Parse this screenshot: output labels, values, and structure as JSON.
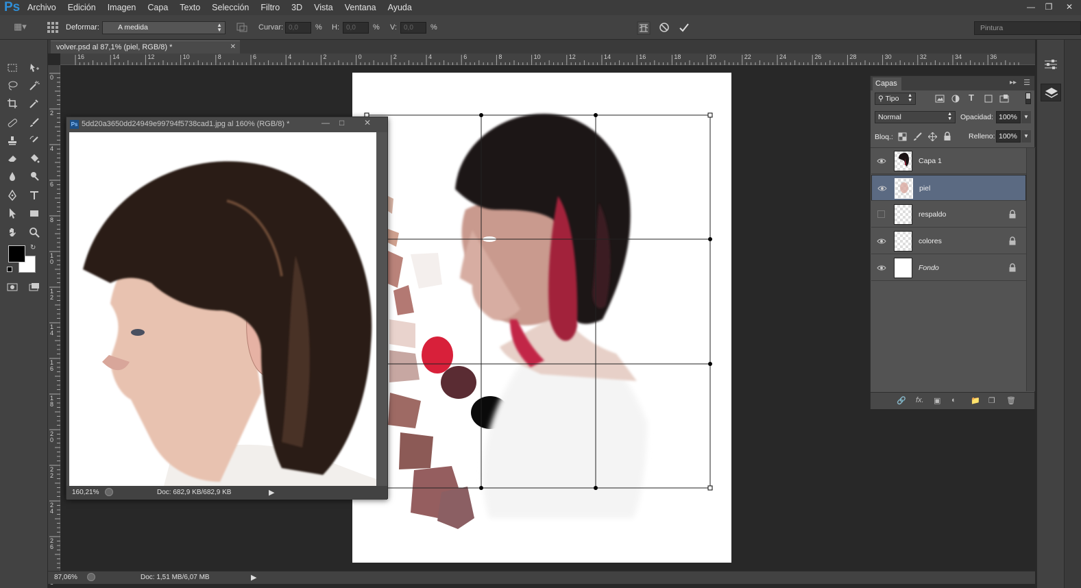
{
  "app": {
    "logo": "Ps",
    "menu": [
      "Archivo",
      "Edición",
      "Imagen",
      "Capa",
      "Texto",
      "Selección",
      "Filtro",
      "3D",
      "Vista",
      "Ventana",
      "Ayuda"
    ]
  },
  "options": {
    "warp_label": "Deformar:",
    "warp_value": "A medida",
    "bend_label": "Curvar:",
    "bend_value": "0,0",
    "pct": "%",
    "h_label": "H:",
    "h_value": "0,0",
    "v_label": "V:",
    "v_value": "0,0",
    "workspace": "Pintura"
  },
  "document": {
    "tab_title": "volver.psd al 87,1% (piel, RGB/8) *",
    "zoom": "87,06%",
    "doc_info": "Doc: 1,51 MB/6,07 MB"
  },
  "ruler": {
    "h": [
      "16",
      "14",
      "12",
      "10",
      "8",
      "6",
      "4",
      "2",
      "0",
      "2",
      "4",
      "6",
      "8",
      "10",
      "12",
      "14",
      "16",
      "18",
      "20",
      "22",
      "24",
      "26",
      "28",
      "30",
      "32",
      "34",
      "36"
    ],
    "v": [
      "0",
      "2",
      "4",
      "6",
      "8",
      "1\n0",
      "1\n2",
      "1\n4",
      "1\n6",
      "1\n8",
      "2\n0",
      "2\n2",
      "2\n4",
      "2\n6",
      "2\n8"
    ]
  },
  "float_window": {
    "title": "5dd20a3650dd24949e99794f5738cad1.jpg al 160% (RGB/8) *",
    "zoom": "160,21%",
    "doc_info": "Doc: 682,9 KB/682,9 KB"
  },
  "layers_panel": {
    "tab": "Capas",
    "filter": "Tipo",
    "blend_mode": "Normal",
    "opacity_label": "Opacidad:",
    "opacity": "100%",
    "lock_label": "Bloq.:",
    "fill_label": "Relleno:",
    "fill": "100%",
    "layers": [
      {
        "name": "Capa 1",
        "visible": true,
        "locked": false,
        "selected": false
      },
      {
        "name": "piel",
        "visible": true,
        "locked": false,
        "selected": true
      },
      {
        "name": "respaldo",
        "visible": false,
        "locked": true,
        "selected": false
      },
      {
        "name": "colores",
        "visible": true,
        "locked": true,
        "selected": false
      },
      {
        "name": "Fondo",
        "visible": true,
        "locked": true,
        "selected": false
      }
    ]
  },
  "colors": {
    "accent": "#2f8fd8",
    "selected_layer": "#5b6a82",
    "panel": "#535353"
  }
}
